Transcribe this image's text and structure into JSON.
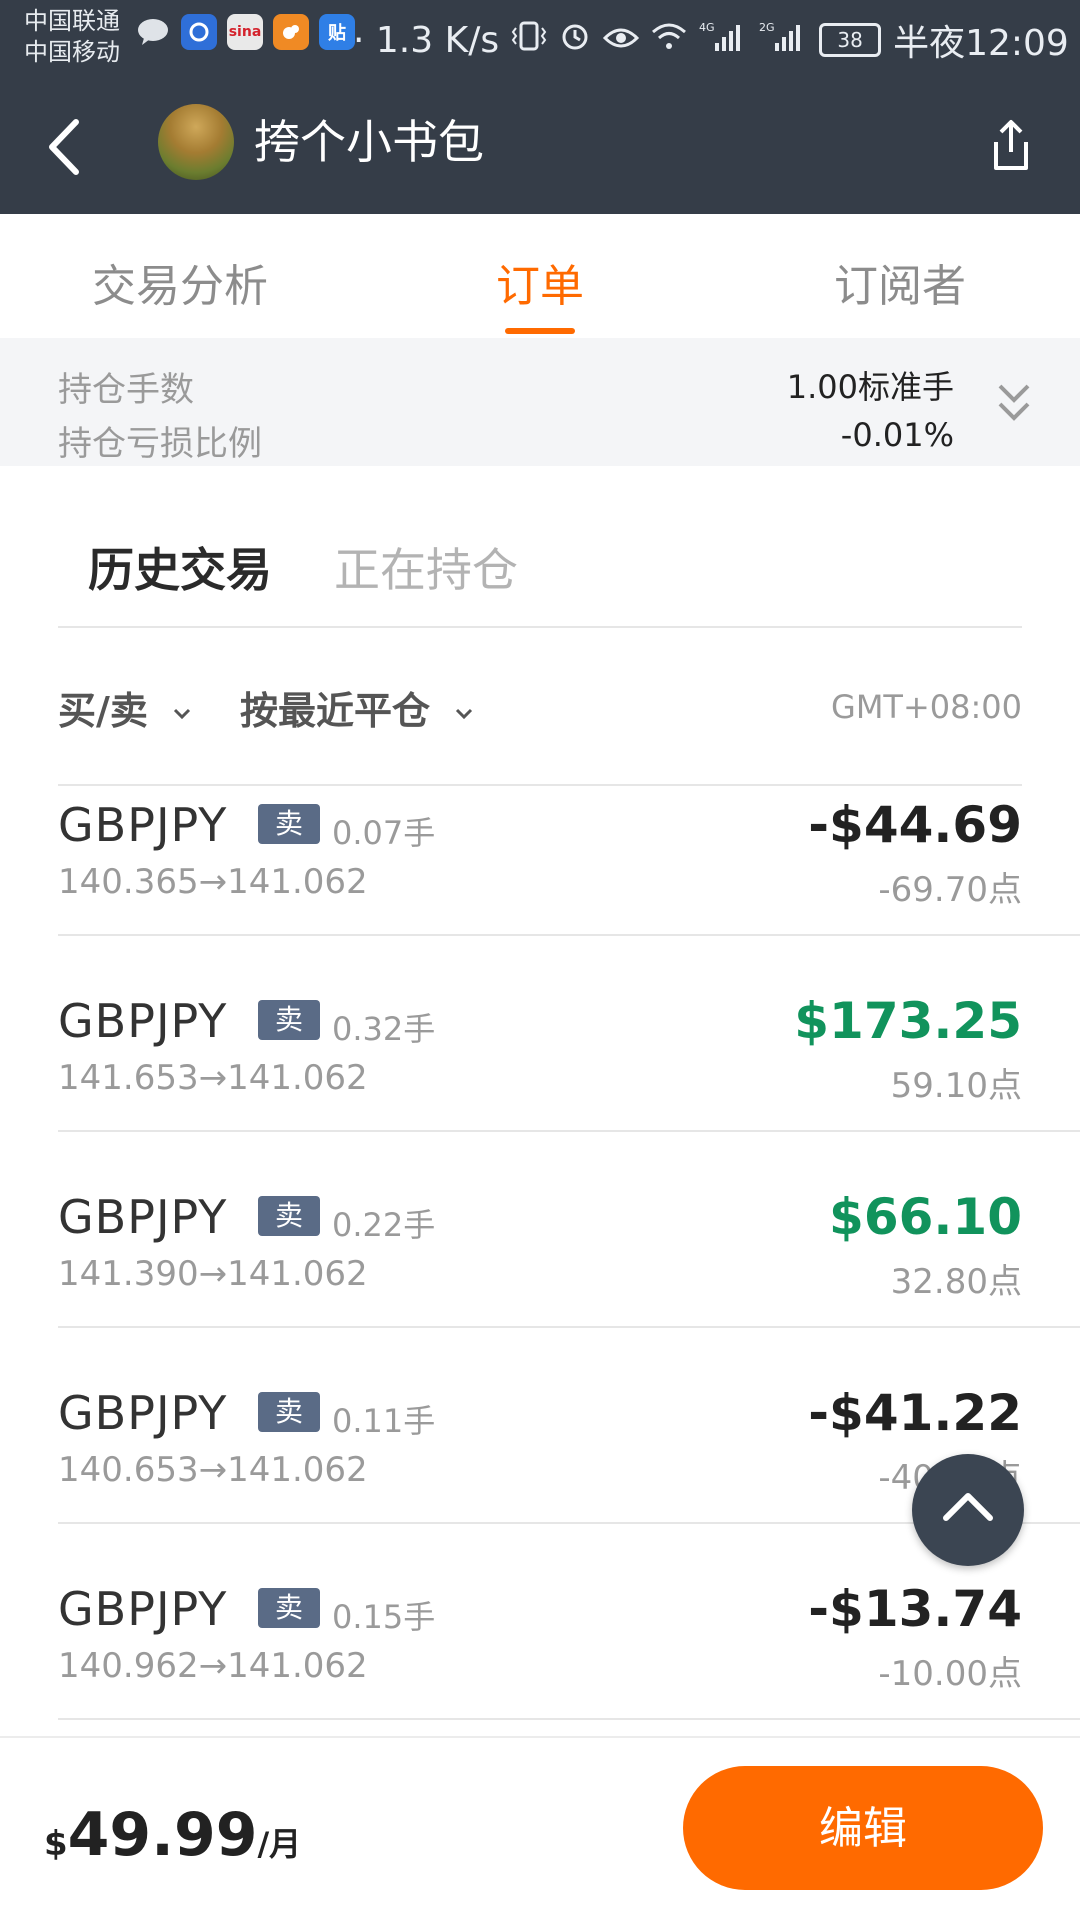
{
  "status_bar": {
    "carrier_1": "中国联通",
    "carrier_2": "中国移动",
    "speed": "· 1.3 K/s",
    "battery": "38",
    "time": "半夜12:09",
    "app_icons": [
      "chat-icon",
      "browser-icon",
      "sina-icon",
      "uc-icon",
      "tieba-icon"
    ],
    "app_icon_labels": {
      "sina": "sina",
      "tieba": "贴"
    }
  },
  "nav": {
    "title": "挎个小书包",
    "back_icon": "chevron-left-icon",
    "share_icon": "share-icon"
  },
  "tabs": [
    {
      "label": "交易分析",
      "active": false
    },
    {
      "label": "订单",
      "active": true
    },
    {
      "label": "订阅者",
      "active": false
    }
  ],
  "summary": {
    "positions_label": "持仓手数",
    "positions_value": "1.00标准手",
    "pl_ratio_label": "持仓亏损比例",
    "pl_ratio_value": "-0.01%"
  },
  "subtabs": {
    "history": "历史交易",
    "holding": "正在持仓"
  },
  "filters": {
    "side": "买/卖",
    "sort": "按最近平仓",
    "timezone": "GMT+08:00"
  },
  "orders": [
    {
      "symbol": "GBPJPY",
      "side": "卖",
      "lots": "0.07手",
      "prices": "140.365→141.062",
      "pl": "-$44.69",
      "points": "-69.70点",
      "positive": false
    },
    {
      "symbol": "GBPJPY",
      "side": "卖",
      "lots": "0.32手",
      "prices": "141.653→141.062",
      "pl": "$173.25",
      "points": "59.10点",
      "positive": true
    },
    {
      "symbol": "GBPJPY",
      "side": "卖",
      "lots": "0.22手",
      "prices": "141.390→141.062",
      "pl": "$66.10",
      "points": "32.80点",
      "positive": true
    },
    {
      "symbol": "GBPJPY",
      "side": "卖",
      "lots": "0.11手",
      "prices": "140.653→141.062",
      "pl": "-$41.22",
      "points": "-40.90点",
      "positive": false
    },
    {
      "symbol": "GBPJPY",
      "side": "卖",
      "lots": "0.15手",
      "prices": "140.962→141.062",
      "pl": "-$13.74",
      "points": "-10.00点",
      "positive": false
    }
  ],
  "colors": {
    "accent": "#ff6a00",
    "positive": "#11935c",
    "negative": "#222222",
    "header_bg": "#353d48"
  },
  "bottom": {
    "currency": "$",
    "amount": "49.99",
    "period": "/月",
    "edit_label": "编辑"
  }
}
